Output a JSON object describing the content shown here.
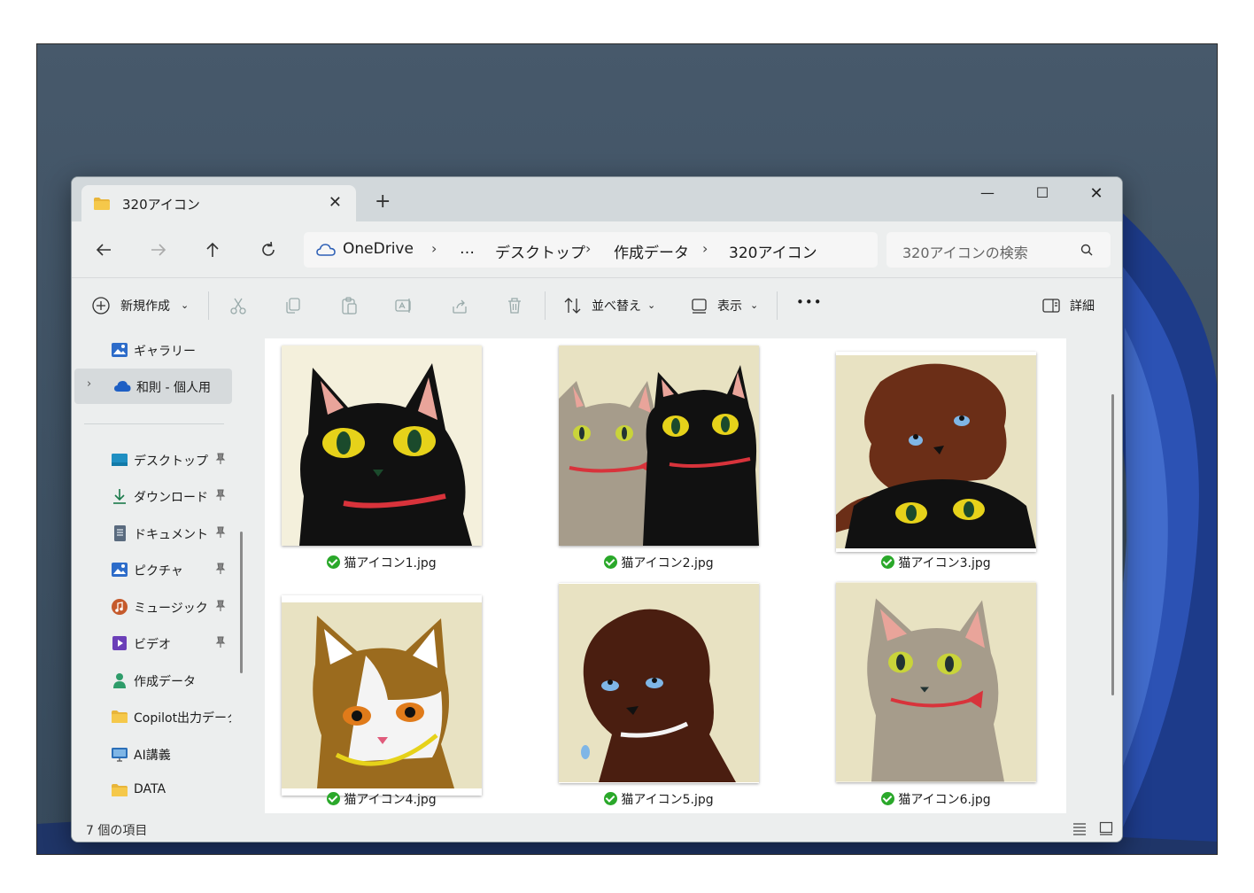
{
  "tab": {
    "title": "320アイコン",
    "close": "✕",
    "new_tab": "+"
  },
  "window_controls": {
    "minimize": "—",
    "maximize": "☐",
    "close": "✕"
  },
  "breadcrumb": {
    "items": [
      "OneDrive",
      "…",
      "デスクトップ",
      "作成データ",
      "320アイコン"
    ],
    "separator": "›"
  },
  "search": {
    "placeholder": "320アイコンの検索"
  },
  "toolbar": {
    "new": "新規作成",
    "sort": "並べ替え",
    "view": "表示",
    "more": "•••",
    "details": "詳細"
  },
  "sidebar": {
    "items": [
      {
        "label": "ギャラリー",
        "icon": "gallery-icon"
      },
      {
        "label": "和則 - 個人用",
        "icon": "onedrive-cloud-icon"
      },
      {
        "label": "デスクトップ",
        "icon": "desktop-icon",
        "pinned": true
      },
      {
        "label": "ダウンロード",
        "icon": "download-icon",
        "pinned": true
      },
      {
        "label": "ドキュメント",
        "icon": "document-icon",
        "pinned": true
      },
      {
        "label": "ピクチャ",
        "icon": "pictures-icon",
        "pinned": true
      },
      {
        "label": "ミュージック",
        "icon": "music-icon",
        "pinned": true
      },
      {
        "label": "ビデオ",
        "icon": "video-icon",
        "pinned": true
      },
      {
        "label": "作成データ",
        "icon": "user-folder-icon"
      },
      {
        "label": "Copilot出力データ",
        "icon": "folder-icon"
      },
      {
        "label": "AI講義",
        "icon": "monitor-folder-icon"
      },
      {
        "label": "DATA",
        "icon": "folder-icon"
      }
    ]
  },
  "files": [
    {
      "name": "猫アイコン1.jpg",
      "status": "synced"
    },
    {
      "name": "猫アイコン2.jpg",
      "status": "synced"
    },
    {
      "name": "猫アイコン3.jpg",
      "status": "synced"
    },
    {
      "name": "猫アイコン4.jpg",
      "status": "synced"
    },
    {
      "name": "猫アイコン5.jpg",
      "status": "synced"
    },
    {
      "name": "猫アイコン6.jpg",
      "status": "synced"
    }
  ],
  "status": {
    "item_count": "7 個の項目"
  },
  "colors": {
    "accent": "#0067c0",
    "sync_ok": "#2aa82a",
    "window_bg": "#eceeee"
  }
}
